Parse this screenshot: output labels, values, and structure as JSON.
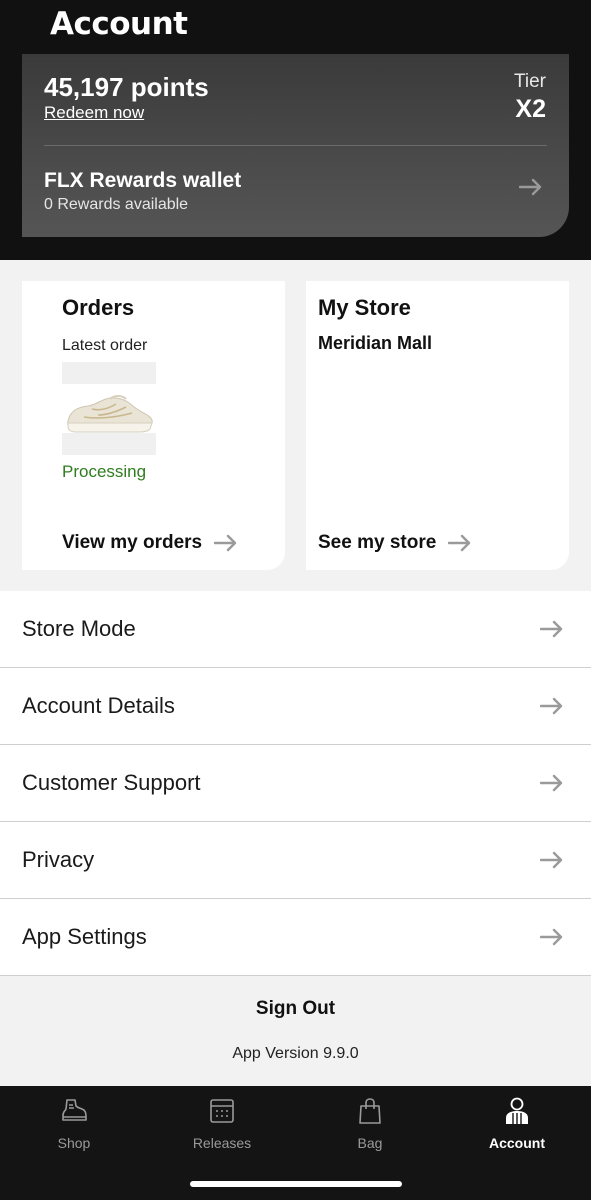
{
  "page": {
    "title": "Account"
  },
  "rewards": {
    "points": "45,197 points",
    "redeem_label": "Redeem now",
    "tier_label": "Tier",
    "tier_value": "X2",
    "wallet_title": "FLX Rewards wallet",
    "wallet_subtitle": "0 Rewards available",
    "wallet_arrow_icon": "arrow-right-icon"
  },
  "orders": {
    "title": "Orders",
    "latest_order_label": "Latest order",
    "status": "Processing",
    "status_color": "#2f7d1f",
    "link_label": "View my orders"
  },
  "store": {
    "title": "My Store",
    "store_name": "Meridian Mall",
    "link_label": "See my store"
  },
  "menu": {
    "items": [
      {
        "label": "Store Mode"
      },
      {
        "label": "Account Details"
      },
      {
        "label": "Customer Support"
      },
      {
        "label": "Privacy"
      },
      {
        "label": "App Settings"
      }
    ]
  },
  "footer": {
    "sign_out_label": "Sign Out",
    "app_version": "App Version 9.9.0"
  },
  "tabbar": {
    "active": "Account",
    "tabs": [
      {
        "label": "Shop",
        "icon": "shoe-icon"
      },
      {
        "label": "Releases",
        "icon": "calendar-icon"
      },
      {
        "label": "Bag",
        "icon": "bag-icon"
      },
      {
        "label": "Account",
        "icon": "person-icon"
      }
    ]
  },
  "colors": {
    "header_bg": "#111111",
    "accent_green": "#2f7d1f",
    "tabbar_bg": "#141414",
    "arrow_gray": "#9a9a9a"
  }
}
